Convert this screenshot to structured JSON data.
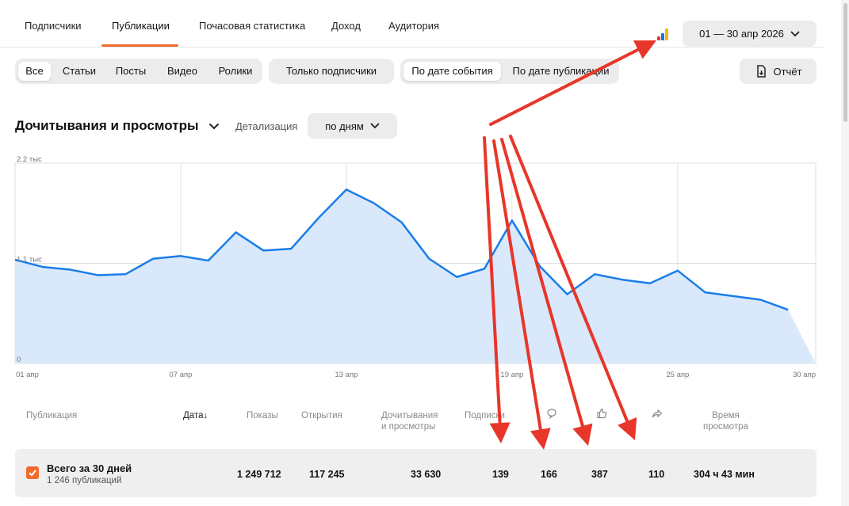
{
  "tabs": [
    "Подписчики",
    "Публикации",
    "Почасовая статистика",
    "Доход",
    "Аудитория"
  ],
  "active_tab": "Публикации",
  "date_range": "01 — 30 апр 2026",
  "filters": {
    "content_types": [
      "Все",
      "Статьи",
      "Посты",
      "Видео",
      "Ролики"
    ],
    "selected_type": "Все",
    "subscribers_only": "Только подписчики",
    "date_modes": [
      "По дате события",
      "По дате публикации"
    ],
    "selected_mode": "По дате события",
    "report": "Отчёт"
  },
  "chart_header": {
    "title": "Дочитывания и просмотры",
    "detail_label": "Детализация",
    "detail_value": "по дням"
  },
  "chart_data": {
    "type": "area",
    "title": "",
    "xlabel": "",
    "ylabel": "",
    "ylim": [
      0,
      2200
    ],
    "y_ticks": [
      "2.2 тыс",
      "1.1 тыс",
      "0"
    ],
    "x_ticks": [
      "01 апр",
      "07 апр",
      "13 апр",
      "19 апр",
      "25 апр",
      "30 апр"
    ],
    "x": [
      "01 апр",
      "02 апр",
      "03 апр",
      "04 апр",
      "05 апр",
      "06 апр",
      "07 апр",
      "08 апр",
      "09 апр",
      "10 апр",
      "11 апр",
      "12 апр",
      "13 апр",
      "14 апр",
      "15 апр",
      "16 апр",
      "17 апр",
      "18 апр",
      "19 апр",
      "20 апр",
      "21 апр",
      "22 апр",
      "23 апр",
      "24 апр",
      "25 апр",
      "26 апр",
      "27 апр",
      "28 апр",
      "29 апр",
      "30 апр"
    ],
    "series": [
      {
        "values": [
          1140,
          1060,
          1030,
          970,
          980,
          1150,
          1180,
          1130,
          1440,
          1240,
          1260,
          1600,
          1910,
          1760,
          1550,
          1150,
          950,
          1040,
          1570,
          1070,
          760,
          980,
          920,
          880,
          1020,
          780,
          740,
          700,
          590,
          0
        ]
      }
    ],
    "grid": true,
    "colors": {
      "line": "#1a7de8",
      "fill": "#d9e9fb"
    }
  },
  "table": {
    "headers": [
      "Публикация",
      "Дата",
      "Показы",
      "Открытия",
      "Дочитывания и просмотры",
      "Подписки",
      "Время просмотра"
    ],
    "date_header": "Дата",
    "reads_header_line1": "Дочитывания",
    "reads_header_line2": "и просмотры",
    "time_header_line1": "Время",
    "time_header_line2": "просмотра",
    "icons": [
      "comment-icon",
      "like-icon",
      "share-icon"
    ],
    "summary": {
      "title": "Всего за 30 дней",
      "subtitle": "1 246 публикаций",
      "impressions": "1 249 712",
      "opens": "117 245",
      "reads": "33 630",
      "subscriptions": "139",
      "comments": "166",
      "likes": "387",
      "shares": "110",
      "watch_time": "304 ч 43 мин"
    }
  },
  "annotation_color": "#e8362a",
  "accent_color": "#f26a2e"
}
